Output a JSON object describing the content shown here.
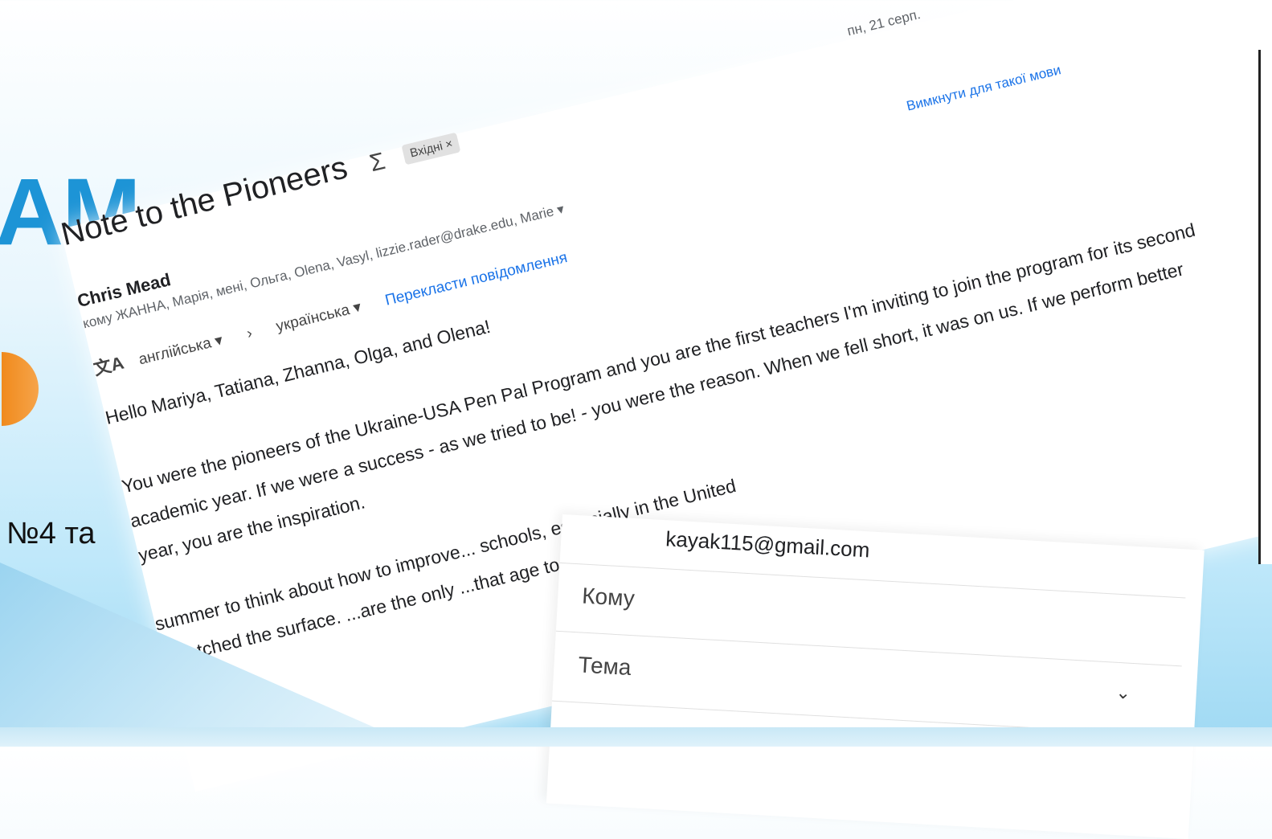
{
  "slide": {
    "title_fragment": "AM",
    "subtitle_fragment": "№4 та"
  },
  "email": {
    "subject": "Note to the Pioneers",
    "sigma": "Σ",
    "inbox_label": "Вхідні ×",
    "date": "пн, 21 серп.",
    "sender": "Chris Mead",
    "recipients": "кому ЖАННА, Марія, мені, Ольга, Olena, Vasyl, lizzie.rader@drake.edu, Marie ▾",
    "turn_off_link": "Вимкнути для такої мови",
    "translate": {
      "icon": "文A",
      "source_lang": "англійська ▾",
      "arrow": "›",
      "target_lang": "українська ▾",
      "translate_link": "Перекласти повідомлення"
    },
    "body": [
      "Hello Mariya, Tatiana, Zhanna, Olga, and Olena!",
      "",
      "You were the pioneers of the Ukraine-USA Pen Pal Program and you are the first teachers I'm inviting to join the program for its second",
      "academic year.  If we were a success - as we tried to be! - you were the reason.  When we fell short, it was on us.  If we perform better",
      "year, you are the inspiration.",
      "",
      "summer to think about how to improve... schools, especially in the United",
      "scratched the surface.  ...are the only ...that age to"
    ]
  },
  "compose": {
    "from": "kayak115@gmail.com",
    "to_label": "Кому",
    "subject_label": "Тема"
  }
}
